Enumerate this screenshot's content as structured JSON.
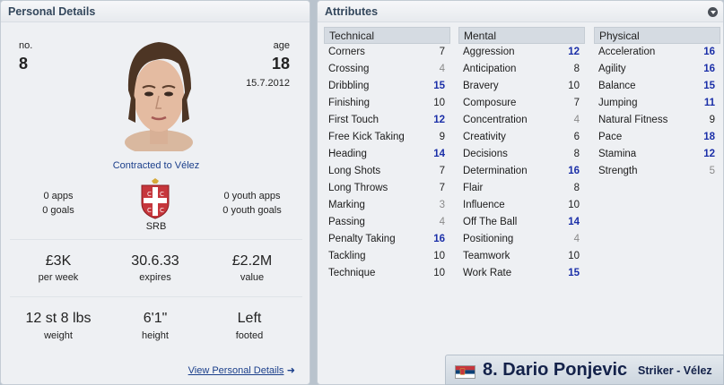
{
  "personal": {
    "title": "Personal Details",
    "number_label": "no.",
    "number": "8",
    "age_label": "age",
    "age": "18",
    "dob": "15.7.2012",
    "contract": "Contracted to Vélez",
    "apps": "0 apps",
    "goals": "0 goals",
    "youth_apps": "0 youth apps",
    "youth_goals": "0 youth goals",
    "nation": "SRB",
    "wage": "£3K",
    "wage_label": "per week",
    "expires": "30.6.33",
    "expires_label": "expires",
    "value": "£2.2M",
    "value_label": "value",
    "weight": "12 st 8 lbs",
    "weight_label": "weight",
    "height": "6'1\"",
    "height_label": "height",
    "foot": "Left",
    "foot_label": "footed",
    "view_link": "View Personal Details",
    "arrow_glyph": "➜"
  },
  "attributes": {
    "title": "Attributes",
    "technical": {
      "label": "Technical",
      "items": [
        {
          "name": "Corners",
          "value": "7"
        },
        {
          "name": "Crossing",
          "value": "4"
        },
        {
          "name": "Dribbling",
          "value": "15"
        },
        {
          "name": "Finishing",
          "value": "10"
        },
        {
          "name": "First Touch",
          "value": "12"
        },
        {
          "name": "Free Kick Taking",
          "value": "9"
        },
        {
          "name": "Heading",
          "value": "14"
        },
        {
          "name": "Long Shots",
          "value": "7"
        },
        {
          "name": "Long Throws",
          "value": "7"
        },
        {
          "name": "Marking",
          "value": "3"
        },
        {
          "name": "Passing",
          "value": "4"
        },
        {
          "name": "Penalty Taking",
          "value": "16"
        },
        {
          "name": "Tackling",
          "value": "10"
        },
        {
          "name": "Technique",
          "value": "10"
        }
      ]
    },
    "mental": {
      "label": "Mental",
      "items": [
        {
          "name": "Aggression",
          "value": "12"
        },
        {
          "name": "Anticipation",
          "value": "8"
        },
        {
          "name": "Bravery",
          "value": "10"
        },
        {
          "name": "Composure",
          "value": "7"
        },
        {
          "name": "Concentration",
          "value": "4"
        },
        {
          "name": "Creativity",
          "value": "6"
        },
        {
          "name": "Decisions",
          "value": "8"
        },
        {
          "name": "Determination",
          "value": "16"
        },
        {
          "name": "Flair",
          "value": "8"
        },
        {
          "name": "Influence",
          "value": "10"
        },
        {
          "name": "Off The Ball",
          "value": "14"
        },
        {
          "name": "Positioning",
          "value": "4"
        },
        {
          "name": "Teamwork",
          "value": "10"
        },
        {
          "name": "Work Rate",
          "value": "15"
        }
      ]
    },
    "physical": {
      "label": "Physical",
      "items": [
        {
          "name": "Acceleration",
          "value": "16"
        },
        {
          "name": "Agility",
          "value": "16"
        },
        {
          "name": "Balance",
          "value": "15"
        },
        {
          "name": "Jumping",
          "value": "11"
        },
        {
          "name": "Natural Fitness",
          "value": "9"
        },
        {
          "name": "Pace",
          "value": "18"
        },
        {
          "name": "Stamina",
          "value": "12"
        },
        {
          "name": "Strength",
          "value": "5"
        }
      ]
    }
  },
  "player": {
    "name": "8. Dario Ponjevic",
    "role": "Striker - Vélez"
  },
  "colors": {
    "high_value": "#1b2fa8",
    "low_value": "#8a8a8a",
    "link": "#1b3f8b",
    "name_text": "#14224a"
  },
  "icons": {
    "dropdown": "chevron-down-circle-icon",
    "flag": "serbia-flag-icon",
    "crest": "serbia-crest-icon",
    "arrow": "arrow-right-icon"
  }
}
